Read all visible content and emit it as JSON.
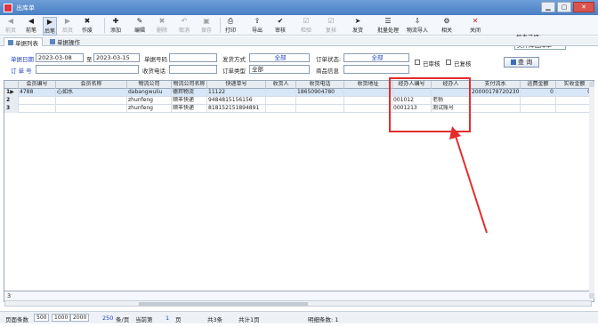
{
  "window": {
    "title": "出库单",
    "min": "▁",
    "max": "▢",
    "close": "✕"
  },
  "toolbar": {
    "buttons": [
      {
        "label": "前页",
        "icon": "◀",
        "enabled": false
      },
      {
        "label": "前笔",
        "icon": "◀",
        "enabled": true
      },
      {
        "label": "后笔",
        "icon": "▶",
        "enabled": true,
        "active": true
      },
      {
        "label": "后页",
        "icon": "▶",
        "enabled": false
      },
      {
        "label": "作废",
        "icon": "✖",
        "enabled": true
      },
      {
        "label": "添加",
        "icon": "✚",
        "enabled": true
      },
      {
        "label": "编辑",
        "icon": "✎",
        "enabled": true
      },
      {
        "label": "删除",
        "icon": "✖",
        "enabled": false
      },
      {
        "label": "取消",
        "icon": "↶",
        "enabled": false
      },
      {
        "label": "保存",
        "icon": "▣",
        "enabled": false
      },
      {
        "label": "打印",
        "icon": "⎙",
        "enabled": true
      },
      {
        "label": "导出",
        "icon": "⇪",
        "enabled": true
      },
      {
        "label": "审核",
        "icon": "✔",
        "enabled": true
      },
      {
        "label": "检验",
        "icon": "☑",
        "enabled": false
      },
      {
        "label": "复核",
        "icon": "☑",
        "enabled": false
      },
      {
        "label": "发货",
        "icon": "➤",
        "enabled": true
      },
      {
        "label": "批量处理",
        "icon": "☰",
        "enabled": true
      },
      {
        "label": "物流导入",
        "icon": "⇩",
        "enabled": true
      },
      {
        "label": "相关",
        "icon": "⚙",
        "enabled": true
      },
      {
        "label": "关闭",
        "icon": "✕",
        "enabled": true
      }
    ],
    "report_label": "报表选择:",
    "report_value": "美萍库出库单"
  },
  "tabs": [
    "单据列表",
    "单据操作"
  ],
  "filter": {
    "date_label": "单据日期",
    "date_from": "2023-03-08",
    "to_label": "至",
    "date_to": "2023-03-15",
    "docno_label": "单据号码",
    "docno_value": "",
    "ship_method_label": "发货方式",
    "ship_method_value": "全部",
    "order_status_label": "订单状态:",
    "order_status_value": "全部",
    "order_no_label": "订 单 号",
    "order_no_value": "",
    "recv_phone_label": "收货电话",
    "recv_phone_value": "",
    "order_type_label": "订单类型",
    "order_type_value": "全部",
    "goods_info_label": "商品信息",
    "goods_info_value": "",
    "audited_label": "已审核",
    "reviewed_label": "已复核",
    "query_label": "查 询"
  },
  "grid": {
    "columns": [
      "会员编号",
      "会员名称",
      "物流公司",
      "物流公司名称",
      "快递单号",
      "收货人",
      "收货电话",
      "收货地址",
      "经办人编号",
      "经办人",
      "支付流水",
      "运费金额",
      "实收金额"
    ],
    "rows": [
      {
        "num": "1",
        "marker": "▶",
        "cells": [
          "4788",
          "心如水",
          "dabangwuliu",
          "德邦物流",
          "11122",
          "",
          "18650904780",
          "",
          "",
          "",
          "20000178720230",
          "0",
          "0"
        ]
      },
      {
        "num": "2",
        "marker": "",
        "cells": [
          "",
          "",
          "zhunfeng",
          "顺丰快递",
          "9484815156156",
          "",
          "",
          "",
          "001012",
          "老杨",
          "",
          "",
          ""
        ]
      },
      {
        "num": "3",
        "marker": "",
        "cells": [
          "",
          "",
          "zhunfeng",
          "顺丰快递",
          "818152151894891",
          "",
          "",
          "",
          "0001213",
          "测试账号",
          "",
          "",
          ""
        ]
      }
    ],
    "row_count": "3"
  },
  "status": {
    "page_rows_label": "页面条数",
    "sizes": [
      "500",
      "1000",
      "2000"
    ],
    "per_page": "250",
    "per_page_unit": "条/页",
    "current_label": "当前第",
    "current_page": "1",
    "page_unit": "页",
    "total": "共3条",
    "pages": "共计1页",
    "detail": "明细条数: 1"
  },
  "colors": {
    "accent": "#4a7fc4",
    "highlight": "#e32d2d",
    "link": "#2040c0"
  }
}
